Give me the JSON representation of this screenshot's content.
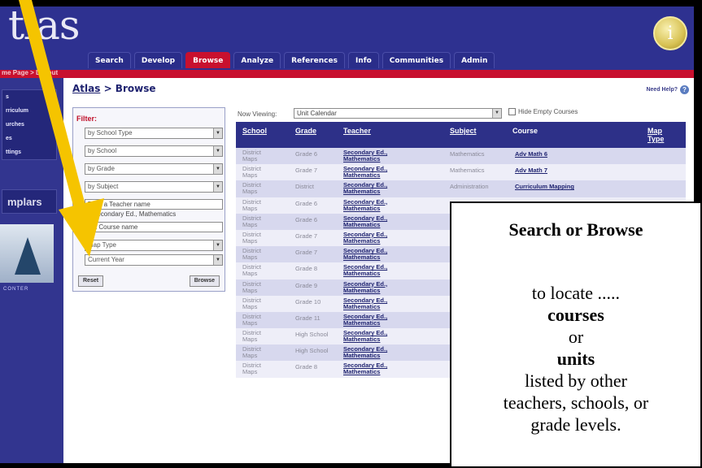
{
  "app": {
    "logo": "tlas",
    "tabs": [
      "Search",
      "Develop",
      "Browse",
      "Analyze",
      "References",
      "Info",
      "Communities",
      "Admin"
    ],
    "active_tab": "Browse",
    "breadcrumb": "me Page > Logout",
    "help_seal_glyph": "i"
  },
  "sidebar": {
    "items": [
      "s",
      "rriculum",
      "urches",
      "es",
      "ttings"
    ],
    "exemplars_label": "mplars",
    "photo_caption": "CONTER"
  },
  "main": {
    "title_link": "Atlas",
    "title_rest": " > Browse",
    "need_help": "Need Help?",
    "need_help_icon": "?"
  },
  "filter": {
    "label": "Filter:",
    "school_type": "by School Type",
    "school": "by School",
    "grade": "by Grade",
    "subject": "by Subject",
    "teacher_placeholder": "Type a Teacher name",
    "teacher_note": "Secondary Ed., Mathematics",
    "course_placeholder": "e a Course name",
    "map_type": "Map Type",
    "year": "Current Year",
    "reset": "Reset",
    "browse": "Browse"
  },
  "viewing": {
    "label": "Now Viewing:",
    "value": "Unit Calendar",
    "hide_empty": "Hide Empty Courses"
  },
  "table": {
    "headers": {
      "school": "School",
      "grade": "Grade",
      "teacher": "Teacher",
      "subject": "Subject",
      "course": "Course",
      "map_type_1": "Map",
      "map_type_2": "Type"
    },
    "rows": [
      {
        "school": [
          "District",
          "Maps"
        ],
        "grade": "Grade 6",
        "teacher": [
          "Secondary Ed.,",
          "Mathematics"
        ],
        "subject": "Mathematics",
        "course": "Adv Math 6"
      },
      {
        "school": [
          "District",
          "Maps"
        ],
        "grade": "Grade 7",
        "teacher": [
          "Secondary Ed.,",
          "Mathematics"
        ],
        "subject": "Mathematics",
        "course": "Adv Math 7"
      },
      {
        "school": [
          "District",
          "Maps"
        ],
        "grade": "District",
        "teacher": [
          "Secondary Ed.,",
          "Mathematics"
        ],
        "subject": "Administration",
        "course": "Curriculum Mapping"
      },
      {
        "school": [
          "District",
          "Maps"
        ],
        "grade": "Grade 6",
        "teacher": [
          "Secondary Ed.,",
          "Mathematics"
        ],
        "subject": "",
        "course": ""
      },
      {
        "school": [
          "District",
          "Maps"
        ],
        "grade": "Grade 6",
        "teacher": [
          "Secondary Ed.,",
          "Mathematics"
        ],
        "subject": "",
        "course": ""
      },
      {
        "school": [
          "District",
          "Maps"
        ],
        "grade": "Grade 7",
        "teacher": [
          "Secondary Ed.,",
          "Mathematics"
        ],
        "subject": "",
        "course": ""
      },
      {
        "school": [
          "District",
          "Maps"
        ],
        "grade": "Grade 7",
        "teacher": [
          "Secondary Ed.,",
          "Mathematics"
        ],
        "subject": "",
        "course": ""
      },
      {
        "school": [
          "District",
          "Maps"
        ],
        "grade": "Grade 8",
        "teacher": [
          "Secondary Ed.,",
          "Mathematics"
        ],
        "subject": "",
        "course": ""
      },
      {
        "school": [
          "District",
          "Maps"
        ],
        "grade": "Grade 9",
        "teacher": [
          "Secondary Ed.,",
          "Mathematics"
        ],
        "subject": "",
        "course": ""
      },
      {
        "school": [
          "District",
          "Maps"
        ],
        "grade": "Grade 10",
        "teacher": [
          "Secondary Ed.,",
          "Mathematics"
        ],
        "subject": "",
        "course": ""
      },
      {
        "school": [
          "District",
          "Maps"
        ],
        "grade": "Grade 11",
        "teacher": [
          "Secondary Ed.,",
          "Mathematics"
        ],
        "subject": "",
        "course": ""
      },
      {
        "school": [
          "District",
          "Maps"
        ],
        "grade": "High School",
        "teacher": [
          "Secondary Ed.,",
          "Mathematics"
        ],
        "subject": "",
        "course": ""
      },
      {
        "school": [
          "District",
          "Maps"
        ],
        "grade": "High School",
        "teacher": [
          "Secondary Ed.,",
          "Mathematics"
        ],
        "subject": "",
        "course": ""
      },
      {
        "school": [
          "District",
          "Maps"
        ],
        "grade": "Grade 8",
        "teacher": [
          "Secondary Ed.,",
          "Mathematics"
        ],
        "subject": "",
        "course": ""
      }
    ]
  },
  "callout": {
    "title": "Search or Browse",
    "line1": "to locate .....",
    "line2": "courses",
    "line3": "or",
    "line4": "units",
    "line5": "listed by other",
    "line6": "teachers, schools, or",
    "line7": "grade levels."
  },
  "colors": {
    "arrow": "#f5c400",
    "nav_blue": "#2e3190",
    "accent_red": "#c8102e"
  }
}
